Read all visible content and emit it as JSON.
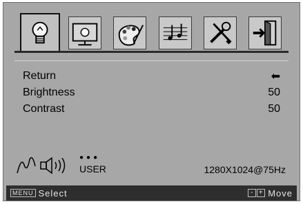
{
  "menu": {
    "items": [
      {
        "label": "Return",
        "value": "⬅"
      },
      {
        "label": "Brightness",
        "value": "50"
      },
      {
        "label": "Contrast",
        "value": "50"
      }
    ]
  },
  "status": {
    "dots": "●●●",
    "mode": "USER",
    "resolution": "1280X1024@75Hz"
  },
  "footer": {
    "menu_key": "MENU",
    "select_label": "Select",
    "minus_key": "-",
    "plus_key": "+",
    "move_label": "Move"
  },
  "icons": [
    "lightbulb-icon",
    "image-icon",
    "palette-icon",
    "audio-icon",
    "tools-icon",
    "exit-icon"
  ]
}
